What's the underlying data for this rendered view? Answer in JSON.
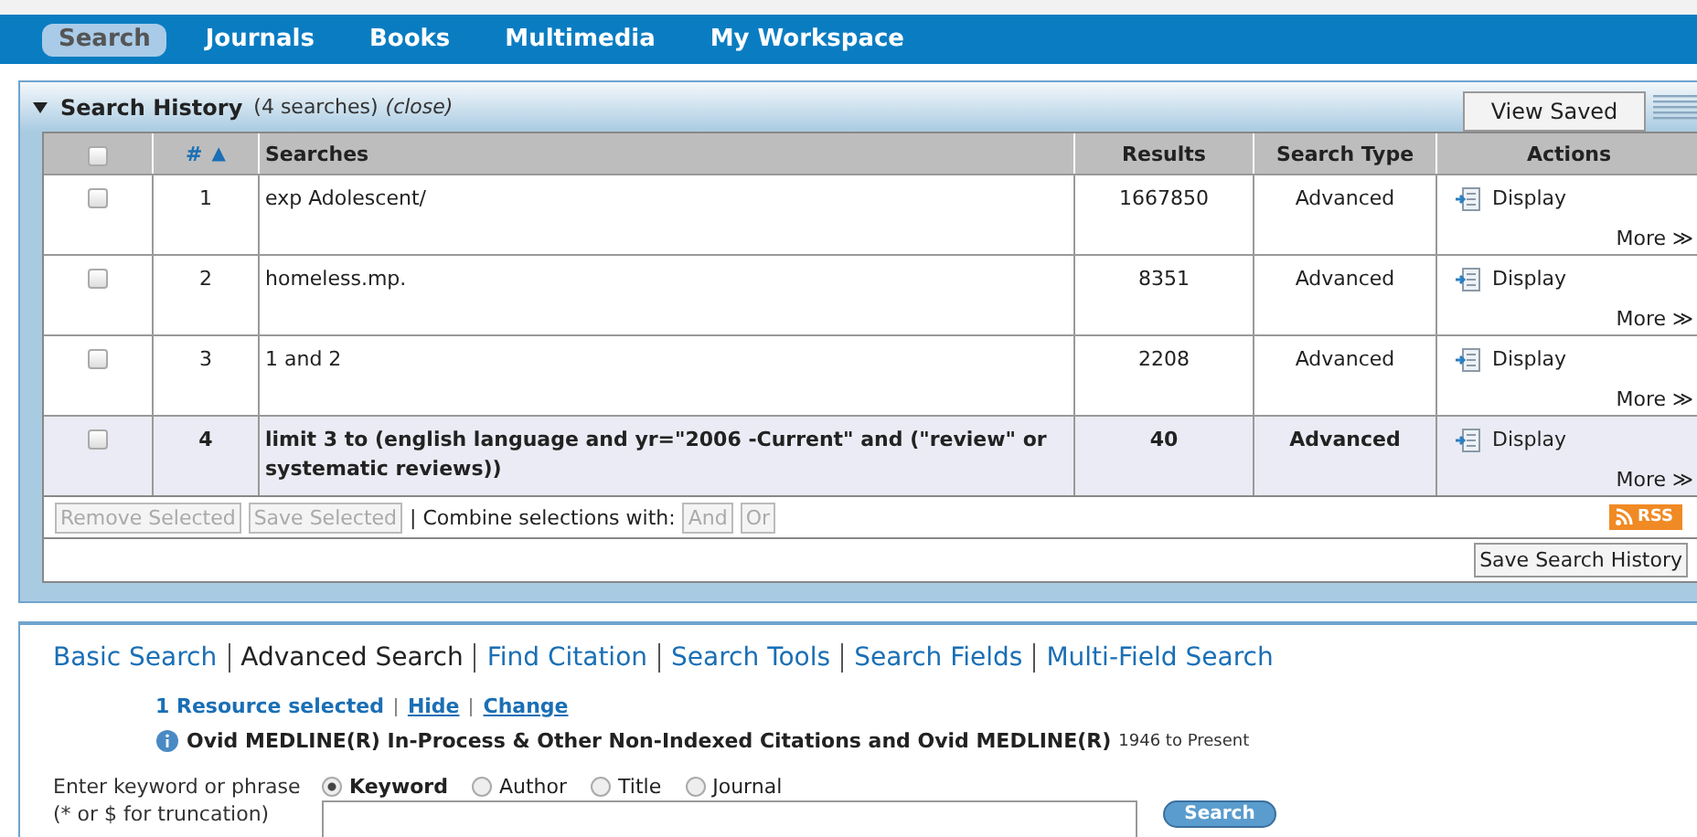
{
  "nav": {
    "tabs": [
      {
        "label": "Search",
        "selected": true
      },
      {
        "label": "Journals",
        "selected": false
      },
      {
        "label": "Books",
        "selected": false
      },
      {
        "label": "Multimedia",
        "selected": false
      },
      {
        "label": "My Workspace",
        "selected": false
      }
    ]
  },
  "search_history": {
    "expanded": true,
    "title": "Search History",
    "count": "(4 searches)",
    "close": "(close)",
    "view_saved": "View Saved",
    "select_all_checked": false,
    "columns": [
      {
        "label": "#",
        "sort_mark": "▲"
      },
      {
        "label": "Searches"
      },
      {
        "label": "Results"
      },
      {
        "label": "Search Type"
      },
      {
        "label": "Actions"
      }
    ],
    "rows": [
      {
        "checked": false,
        "current": false,
        "number": "1",
        "search": "exp Adolescent/",
        "results": "1667850",
        "type": "Advanced",
        "action": "Display",
        "more": "More ≫"
      },
      {
        "checked": false,
        "current": false,
        "number": "2",
        "search": "homeless.mp.",
        "results": "8351",
        "type": "Advanced",
        "action": "Display",
        "more": "More ≫"
      },
      {
        "checked": false,
        "current": false,
        "number": "3",
        "search": "1 and 2",
        "results": "2208",
        "type": "Advanced",
        "action": "Display",
        "more": "More ≫"
      },
      {
        "checked": false,
        "current": true,
        "number": "4",
        "search": "limit 3 to (english language and yr=\"2006 -Current\" and (\"review\" or systematic reviews))",
        "results": "40",
        "type": "Advanced",
        "action": "Display",
        "more": "More ≫"
      }
    ],
    "toolbar": {
      "buttons": [
        {
          "label": "Remove Selected",
          "disabled": true
        },
        {
          "label": "Save Selected",
          "disabled": true
        }
      ],
      "combine_label": "| Combine selections with:",
      "combine_buttons": [
        {
          "label": "And",
          "disabled": true
        },
        {
          "label": "Or",
          "disabled": true
        }
      ],
      "rss": "RSS"
    },
    "save_history": "Save Search History"
  },
  "search_panel": {
    "modes": [
      {
        "label": "Basic Search",
        "selected": false
      },
      {
        "label": "Advanced Search",
        "selected": true
      },
      {
        "label": "Find Citation",
        "selected": false
      },
      {
        "label": "Search Tools",
        "selected": false
      },
      {
        "label": "Search Fields",
        "selected": false
      },
      {
        "label": "Multi-Field Search",
        "selected": false
      }
    ],
    "resources": {
      "count": "1 Resource selected",
      "links": [
        "Hide",
        "Change"
      ]
    },
    "database": {
      "name": "Ovid MEDLINE(R) In-Process & Other Non-Indexed Citations and Ovid MEDLINE(R)",
      "range": "1946 to Present"
    },
    "prompt": [
      "Enter keyword or phrase",
      "(* or $ for truncation)"
    ],
    "fields": [
      {
        "label": "Keyword",
        "selected": true
      },
      {
        "label": "Author",
        "selected": false
      },
      {
        "label": "Title",
        "selected": false
      },
      {
        "label": "Journal",
        "selected": false
      }
    ],
    "search_button": "Search"
  }
}
